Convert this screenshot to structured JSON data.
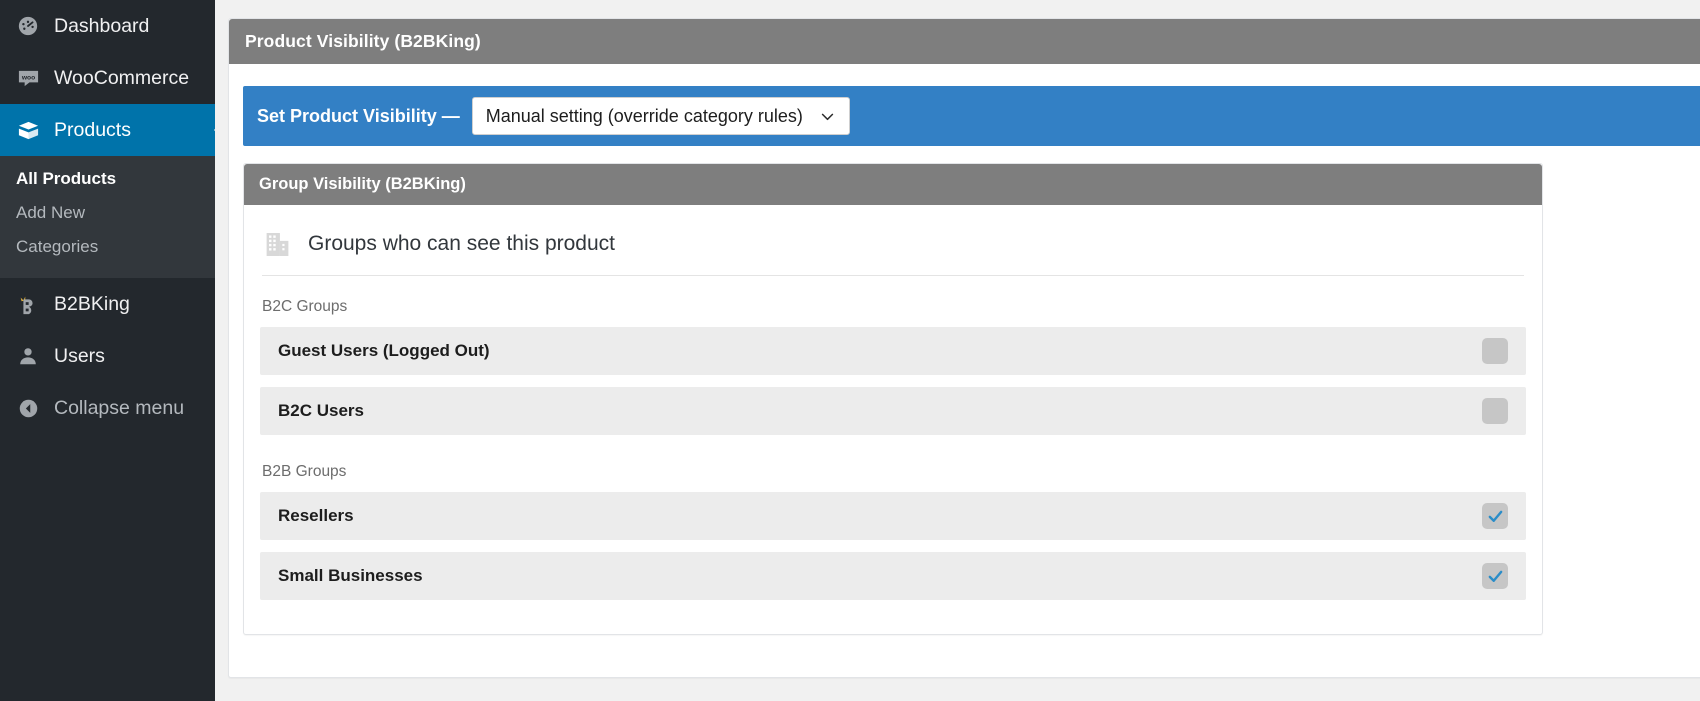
{
  "sidebar": {
    "items": [
      {
        "label": "Dashboard",
        "icon": "dashboard-icon",
        "current": false
      },
      {
        "label": "WooCommerce",
        "icon": "woocommerce-icon",
        "current": false
      },
      {
        "label": "Products",
        "icon": "products-box-icon",
        "current": true
      },
      {
        "label": "B2BKing",
        "icon": "b2bking-icon",
        "current": false
      },
      {
        "label": "Users",
        "icon": "users-icon",
        "current": false
      },
      {
        "label": "Collapse menu",
        "icon": "collapse-arrow-icon",
        "current": false
      }
    ],
    "submenu": [
      {
        "label": "All Products",
        "current": true
      },
      {
        "label": "Add New",
        "current": false
      },
      {
        "label": "Categories",
        "current": false
      }
    ]
  },
  "panel": {
    "title": "Product Visibility (B2BKing)",
    "visibility_bar": {
      "label": "Set Product Visibility —",
      "selected": "Manual setting (override category rules)",
      "chevron": "chevron-down-icon"
    },
    "inner": {
      "title": "Group Visibility (B2BKing)",
      "section_icon": "building-icon",
      "section_title": "Groups who can see this product",
      "sections": [
        {
          "label": "B2C Groups",
          "rows": [
            {
              "name": "Guest Users (Logged Out)",
              "checked": false
            },
            {
              "name": "B2C Users",
              "checked": false
            }
          ]
        },
        {
          "label": "B2B Groups",
          "rows": [
            {
              "name": "Resellers",
              "checked": true
            },
            {
              "name": "Small Businesses",
              "checked": true
            }
          ]
        }
      ]
    }
  },
  "colors": {
    "sidebar_bg": "#23282d",
    "sidebar_current": "#0073aa",
    "panel_header": "#7e7e7e",
    "accent_blue": "#3380c5",
    "check_blue": "#2b8dc8",
    "row_bg": "#ececec"
  }
}
